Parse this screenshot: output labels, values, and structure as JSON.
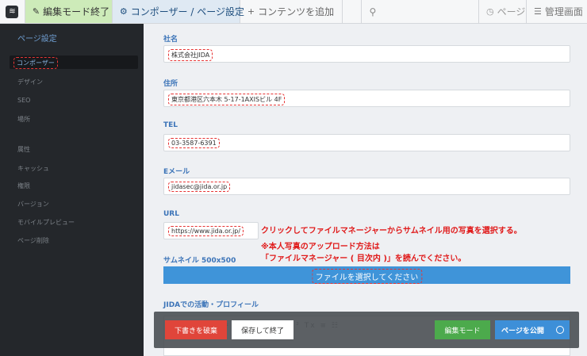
{
  "toolbar": {
    "logo_glyph": "≋",
    "edit_mode_end": "編集モード終了",
    "composer_settings": "コンポーザー / ページ設定",
    "add_contents": "コンテンツを追加",
    "page": "ページ",
    "admin": "管理画面"
  },
  "sidebar": {
    "title": "ページ設定",
    "active_item": "コンポーザー",
    "items": [
      "デザイン",
      "SEO",
      "場所",
      "属性",
      "キャッシュ",
      "権限",
      "バージョン",
      "モバイルプレビュー",
      "ページ削除"
    ]
  },
  "form": {
    "company_label": "社名",
    "company_value": "株式会社JIDA",
    "address_label": "住所",
    "address_value": "東京都港区六本木 5-17-1AXISビル 4F",
    "tel_label": "TEL",
    "tel_value": "03-3587-6391",
    "email_label": "Eメール",
    "email_value": "jidasec@jida.or.jp",
    "url_label": "URL",
    "url_value": "https://www.jida.or.jp/",
    "thumbnail_label": "サムネイル 500x500",
    "file_select": "ファイルを選択してください",
    "profile_label": "JIDAでの活動・プロフィール"
  },
  "annotations": {
    "line1": "クリックしてファイルマネージャーからサムネイル用の写真を選択する。",
    "line2": "※本人写真のアップロード方法は",
    "line3": "「ファイルマネージャー ( 目次内 )」を読んでください。"
  },
  "bottombar": {
    "discard": "下書きを破棄",
    "save_exit": "保存して終了",
    "edit_mode": "編集モード",
    "publish": "ページを公開"
  },
  "colors": {
    "accent_blue": "#3f94d9",
    "annotation_red": "#e01a1a",
    "discard_red": "#e0453a",
    "edit_green": "#4caa4c"
  }
}
